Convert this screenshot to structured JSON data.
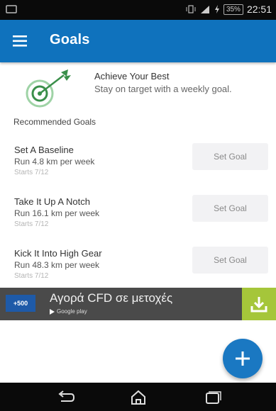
{
  "status_bar": {
    "time": "22:51",
    "battery": "35%"
  },
  "app_bar": {
    "title": "Goals"
  },
  "intro": {
    "heading": "Achieve Your Best",
    "subtitle": "Stay on target with a weekly goal."
  },
  "section_title": "Recommended Goals",
  "goals": [
    {
      "title": "Set A Baseline",
      "description": "Run 4.8 km per week",
      "starts": "Starts 7/12",
      "button": "Set Goal"
    },
    {
      "title": "Take It Up A Notch",
      "description": "Run 16.1 km per week",
      "starts": "Starts 7/12",
      "button": "Set Goal"
    },
    {
      "title": "Kick It Into High Gear",
      "description": "Run 48.3 km per week",
      "starts": "Starts 7/12",
      "button": "Set Goal"
    }
  ],
  "ad": {
    "logo": "+500",
    "title": "Αγορά CFD σε μετοχές",
    "source": "Google play"
  },
  "colors": {
    "primary": "#0f72bd",
    "fab": "#1a78c2",
    "ad_download": "#a5c63a",
    "target_icon": "#3a8f4a"
  }
}
